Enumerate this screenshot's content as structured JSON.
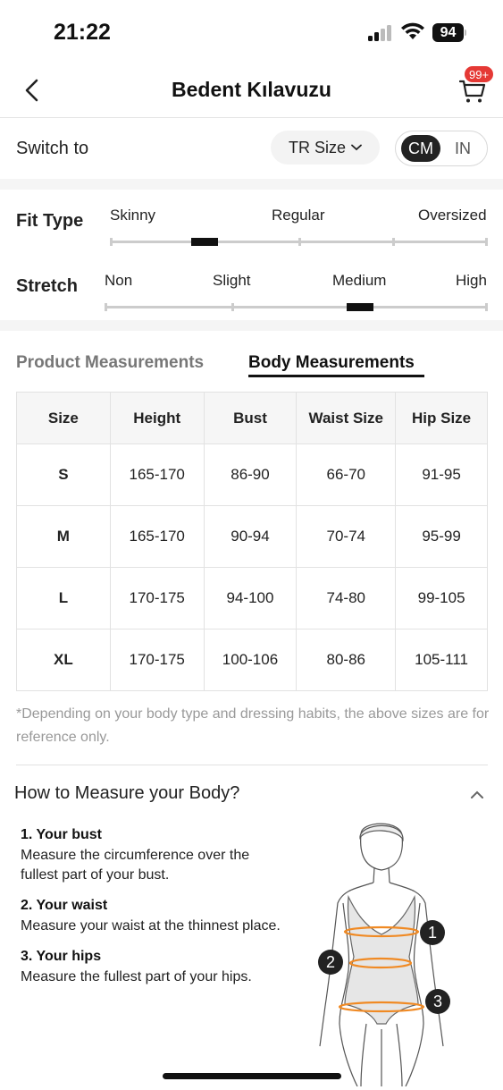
{
  "status_bar": {
    "time": "21:22",
    "battery": "94"
  },
  "nav": {
    "title": "Bedent Kılavuzu",
    "cart_badge": "99+"
  },
  "switch": {
    "label": "Switch to",
    "size_system": "TR Size",
    "units": [
      "CM",
      "IN"
    ],
    "selected_unit": "CM"
  },
  "fit": {
    "fit_type": {
      "label": "Fit Type",
      "options": [
        "Skinny",
        "Regular",
        "Oversized"
      ],
      "level": 0.25
    },
    "stretch": {
      "label": "Stretch",
      "options": [
        "Non",
        "Slight",
        "Medium",
        "High"
      ],
      "level": 0.67
    }
  },
  "tabs": {
    "product": "Product Measurements",
    "body": "Body Measurements",
    "active": "body"
  },
  "table": {
    "headers": [
      "Size",
      "Height",
      "Bust",
      "Waist Size",
      "Hip Size"
    ],
    "rows": [
      [
        "S",
        "165-170",
        "86-90",
        "66-70",
        "91-95"
      ],
      [
        "M",
        "165-170",
        "90-94",
        "70-74",
        "95-99"
      ],
      [
        "L",
        "170-175",
        "94-100",
        "74-80",
        "99-105"
      ],
      [
        "XL",
        "170-175",
        "100-106",
        "80-86",
        "105-111"
      ]
    ]
  },
  "note": "*Depending on your body type and dressing habits, the above sizes are for reference only.",
  "howto": {
    "title": "How to Measure your Body?",
    "steps": [
      {
        "title": "1. Your bust",
        "desc": "Measure the circumference over the fullest part of your bust."
      },
      {
        "title": "2. Your waist",
        "desc": "Measure your waist at the thinnest place."
      },
      {
        "title": "3. Your hips",
        "desc": "Measure the fullest part of your hips."
      }
    ],
    "figure_markers": [
      "1",
      "2",
      "3"
    ]
  },
  "colors": {
    "accent_orange": "#f08a24",
    "badge_red": "#e53935"
  }
}
